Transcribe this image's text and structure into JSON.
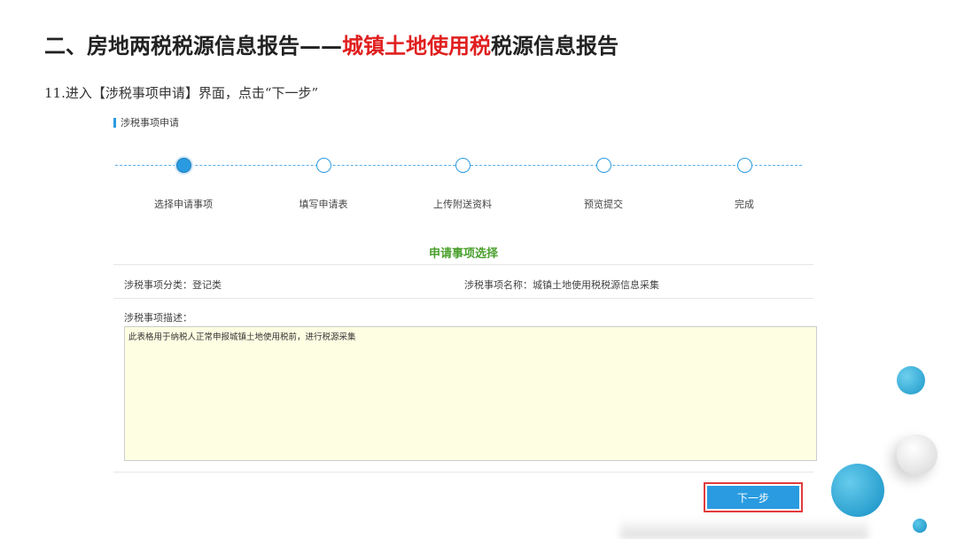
{
  "slide": {
    "title_prefix": "二、房地两税税源信息报告——",
    "title_highlight": "城镇土地使用税",
    "title_suffix": "税源信息报告",
    "instruction": "11.进入【涉税事项申请】界面，点击“下一步”"
  },
  "panel": {
    "title": "涉税事项申请"
  },
  "stepper": {
    "steps": [
      {
        "label": "选择申请事项",
        "active": true
      },
      {
        "label": "填写申请表",
        "active": false
      },
      {
        "label": "上传附送资料",
        "active": false
      },
      {
        "label": "预览提交",
        "active": false
      },
      {
        "label": "完成",
        "active": false
      }
    ]
  },
  "form": {
    "section_heading": "申请事项选择",
    "category": "涉税事项分类：登记类",
    "item_name": "涉税事项名称：城镇土地使用税税源信息采集",
    "description_label": "涉税事项描述：",
    "description_text": "此表格用于纳税人正常申报城镇土地使用税前，进行税源采集"
  },
  "buttons": {
    "next_label": "下一步"
  },
  "colors": {
    "accent": "#2a9be0",
    "highlight": "#e01f1f",
    "section_heading": "#4aa02c",
    "button_outline": "#e23b3b"
  }
}
